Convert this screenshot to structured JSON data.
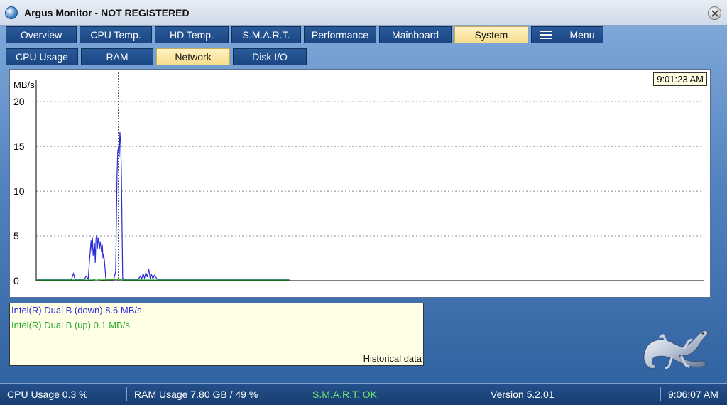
{
  "window": {
    "title": "Argus Monitor - NOT REGISTERED",
    "app_icon": "argus-globe-icon",
    "close_icon": "close-icon"
  },
  "tabs": {
    "main": [
      {
        "label": "Overview",
        "active": false
      },
      {
        "label": "CPU Temp.",
        "active": false
      },
      {
        "label": "HD Temp.",
        "active": false
      },
      {
        "label": "S.M.A.R.T.",
        "active": false
      },
      {
        "label": "Performance",
        "active": false
      },
      {
        "label": "Mainboard",
        "active": false
      },
      {
        "label": "System",
        "active": true
      }
    ],
    "menu_label": "Menu",
    "menu_icon": "hamburger-icon",
    "sub": [
      {
        "label": "CPU Usage",
        "active": false
      },
      {
        "label": "RAM",
        "active": false
      },
      {
        "label": "Network",
        "active": true
      },
      {
        "label": "Disk I/O",
        "active": false
      }
    ]
  },
  "chart": {
    "time_label": "9:01:23 AM",
    "legend_down": "Intel(R) Dual B (down) 8.6 MB/s",
    "legend_up": "Intel(R) Dual B (up) 0.1 MB/s",
    "historical_label": "Historical data"
  },
  "chart_data": {
    "type": "line",
    "ylabel": "MB/s",
    "ylim": [
      0,
      22
    ],
    "yticks": [
      0,
      5,
      10,
      15,
      20
    ],
    "grid": true,
    "colors": {
      "down": "#2a2ad8",
      "up": "#2aa82a",
      "cursor": "#000000"
    },
    "cursor_x": 117,
    "x_range": [
      0,
      950
    ],
    "series": [
      {
        "key": "down",
        "values": [
          [
            0,
            0.1
          ],
          [
            50,
            0.1
          ],
          [
            53,
            0.8
          ],
          [
            55,
            0.2
          ],
          [
            58,
            0.1
          ],
          [
            68,
            0.1
          ],
          [
            71,
            0.5
          ],
          [
            74,
            0.2
          ],
          [
            76,
            2.5
          ],
          [
            78,
            4.5
          ],
          [
            79,
            3.2
          ],
          [
            80,
            4.8
          ],
          [
            81,
            2.8
          ],
          [
            82,
            3.5
          ],
          [
            83,
            4.2
          ],
          [
            84,
            2.0
          ],
          [
            85,
            4.6
          ],
          [
            86,
            5.1
          ],
          [
            87,
            3.6
          ],
          [
            88,
            4.8
          ],
          [
            89,
            4.2
          ],
          [
            90,
            3.5
          ],
          [
            91,
            4.4
          ],
          [
            92,
            3.8
          ],
          [
            93,
            3.2
          ],
          [
            94,
            4.0
          ],
          [
            95,
            2.5
          ],
          [
            96,
            3.0
          ],
          [
            97,
            2.2
          ],
          [
            98,
            1.2
          ],
          [
            99,
            0.2
          ],
          [
            104,
            0.1
          ],
          [
            110,
            0.1
          ],
          [
            113,
            1.0
          ],
          [
            114,
            6.5
          ],
          [
            115,
            12.0
          ],
          [
            116,
            14.5
          ],
          [
            117,
            14.8
          ],
          [
            118,
            13.8
          ],
          [
            119,
            16.6
          ],
          [
            120,
            15.4
          ],
          [
            121,
            12.5
          ],
          [
            122,
            6.8
          ],
          [
            123,
            0.3
          ],
          [
            126,
            0.1
          ],
          [
            145,
            0.1
          ],
          [
            148,
            0.5
          ],
          [
            150,
            0.2
          ],
          [
            152,
            0.8
          ],
          [
            154,
            0.3
          ],
          [
            156,
            0.9
          ],
          [
            158,
            0.4
          ],
          [
            160,
            1.3
          ],
          [
            162,
            0.3
          ],
          [
            164,
            0.7
          ],
          [
            166,
            0.2
          ],
          [
            168,
            0.6
          ],
          [
            170,
            0.4
          ],
          [
            172,
            0.2
          ],
          [
            175,
            0.1
          ],
          [
            360,
            0.1
          ]
        ]
      },
      {
        "key": "up",
        "values": [
          [
            0,
            0.08
          ],
          [
            80,
            0.08
          ],
          [
            86,
            0.18
          ],
          [
            92,
            0.08
          ],
          [
            120,
            0.15
          ],
          [
            125,
            0.08
          ],
          [
            360,
            0.08
          ]
        ]
      }
    ]
  },
  "status": {
    "cpu": "CPU Usage 0.3 %",
    "ram": "RAM Usage 7.80 GB / 49 %",
    "smart": "S.M.A.R.T. OK",
    "version": "Version 5.2.01",
    "clock": "9:06:07 AM"
  },
  "logo_icon": "salamander-logo-icon"
}
